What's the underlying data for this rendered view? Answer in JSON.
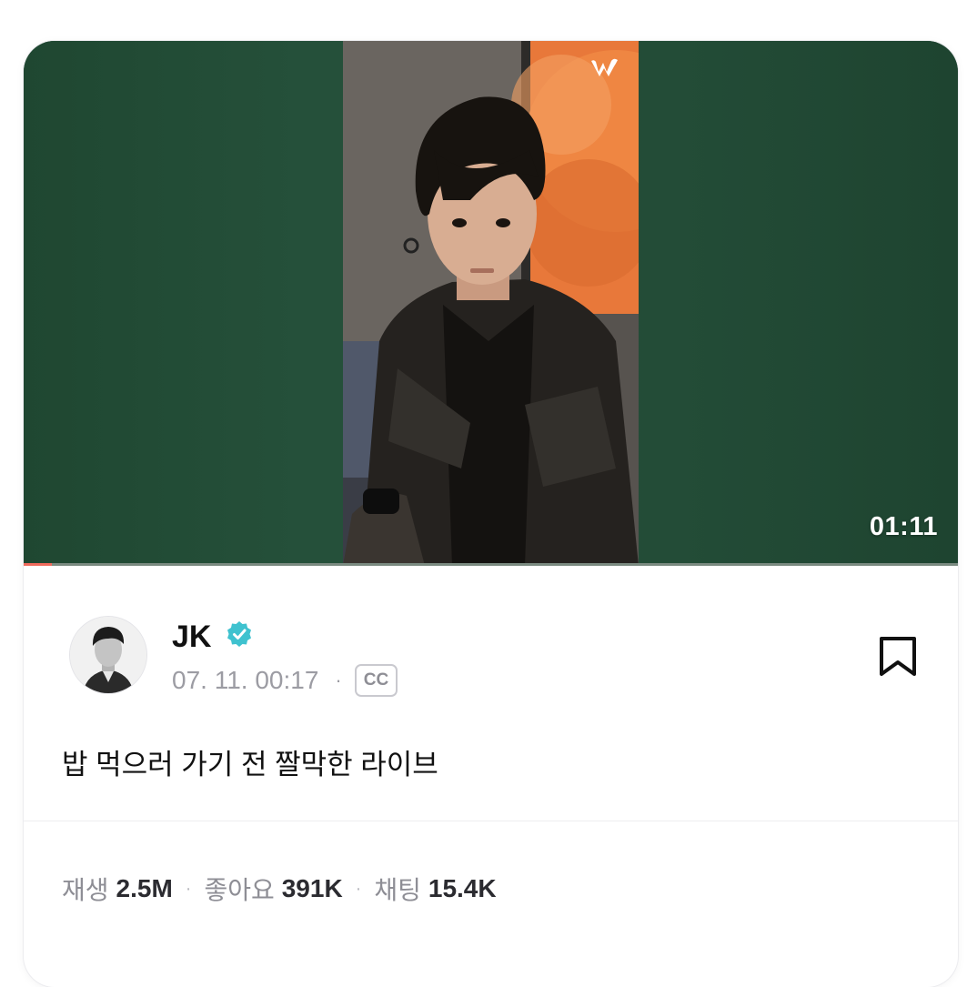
{
  "video": {
    "duration": "01:11",
    "progress_fraction": 0.03,
    "watermark_icon": "weverse-logo",
    "background_color": "#234a35",
    "progress_color": "#ef6a5c"
  },
  "post": {
    "author": "JK",
    "verified_icon": "verified-badge-icon",
    "verified_color": "#3fc2cf",
    "timestamp": "07. 11. 00:17",
    "dot": "·",
    "cc_label": "CC",
    "bookmark_icon": "bookmark-icon",
    "caption": "밥 먹으러 가기 전 짤막한 라이브"
  },
  "stats": {
    "plays_label": "재생",
    "plays_value": "2.5M",
    "likes_label": "좋아요",
    "likes_value": "391K",
    "chats_label": "채팅",
    "chats_value": "15.4K",
    "separator": "·"
  }
}
